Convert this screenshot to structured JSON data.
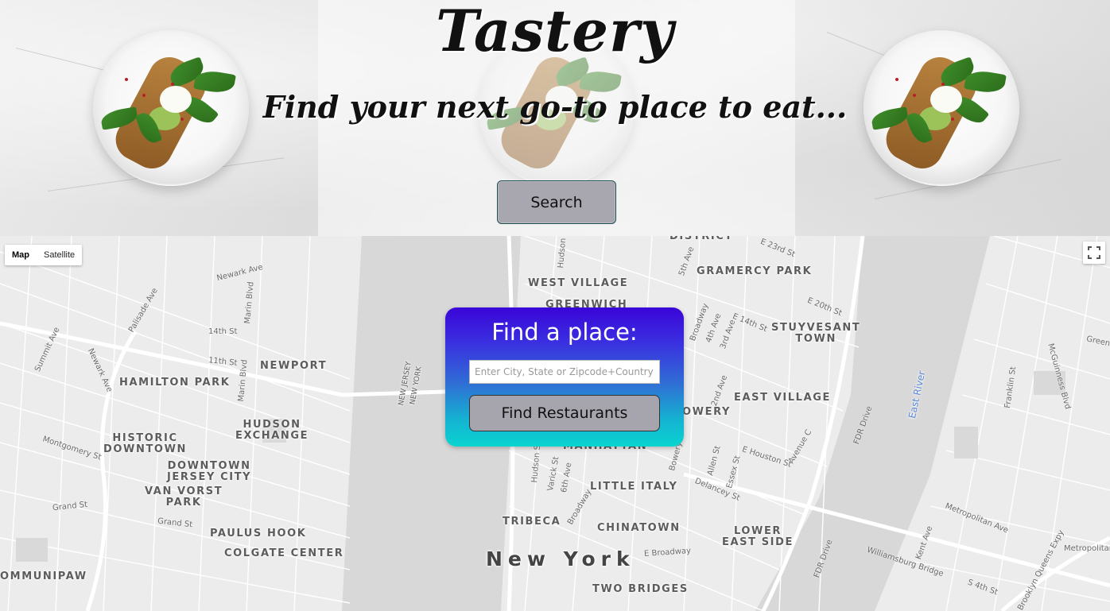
{
  "hero": {
    "title": "Tastery",
    "tagline": "Find your next go-to place to eat...",
    "search_label": "Search"
  },
  "map": {
    "map_type_options": [
      "Map",
      "Satellite"
    ],
    "active_map_type": "Map",
    "fullscreen_icon": "fullscreen-icon",
    "neighborhoods": {
      "district": "DISTRICT",
      "west_village": "WEST VILLAGE",
      "greenwich": "GREENWICH",
      "gramercy_park": "GRAMERCY PARK",
      "stuyvesant_town": "STUYVESANT\nTOWN",
      "newport": "NEWPORT",
      "hamilton_park": "HAMILTON PARK",
      "hudson_exchange": "HUDSON\nEXCHANGE",
      "historic_downtown": "HISTORIC\nDOWNTOWN",
      "downtown_jersey_city": "DOWNTOWN\nJERSEY CITY",
      "van_vorst_park": "VAN VORST\nPARK",
      "paulus_hook": "PAULUS HOOK",
      "colgate_center": "COLGATE CENTER",
      "communipaw": "OMMUNIPAW",
      "east_village": "EAST VILLAGE",
      "bowery": "OWERY",
      "manhattan": "MANHATTAN",
      "little_italy": "LITTLE ITALY",
      "tribeca": "TRIBECA",
      "chinatown": "CHINATOWN",
      "lower_east_side": "LOWER\nEAST SIDE",
      "new_york": "New York",
      "two_bridges": "TWO BRIDGES"
    },
    "streets": {
      "newark_ave": "Newark Ave",
      "marin_blvd": "Marin Blvd",
      "palisade_ave": "Palisade Ave",
      "summit_ave": "Summit Ave",
      "14th_st": "14th St",
      "11th_st": "11th St",
      "newark_ave_2": "Newark Ave",
      "marin_blvd_2": "Marin Blvd",
      "montgomery_st": "Montgomery St",
      "grand_st": "Grand St",
      "grand_st_2": "Grand St",
      "hudson_st": "Hudson St",
      "5th_ave": "5th Ave",
      "e_23rd_st": "E 23rd St",
      "e_20th_st": "E 20th St",
      "broadway": "Broadway",
      "4th_ave": "4th Ave",
      "3rd_ave": "3rd Ave",
      "e_14th_st": "E 14th St",
      "2nd_ave": "2nd Ave",
      "fdr_drive": "FDR Drive",
      "avenue_c": "Avenue C",
      "e_houston_st": "E Houston St",
      "allen_st": "Allen St",
      "essex_st": "Essex St",
      "delancey_st": "Delancey St",
      "bowery_st": "Bowery",
      "hudson_st_2": "Hudson St",
      "varick_st": "Varick St",
      "6th_ave": "6th Ave",
      "broadway_2": "Broadway",
      "e_broadway": "E Broadway",
      "williamsburg_bridge": "Williamsburg Bridge",
      "fdr_drive_2": "FDR Drive",
      "kent_ave": "Kent Ave",
      "metropolitan_ave": "Metropolitan Ave",
      "metropolitan_2": "Metropolitan",
      "brooklyn_queens_expy": "Brooklyn Queens Expy",
      "s_4th_st": "S 4th St",
      "franklin_st": "Franklin St",
      "mcguinness_blvd": "McGuinness Blvd",
      "greenp": "Greenp",
      "nj_ny": "NEW JERSEY\nNEW YORK",
      "east_river": "East River"
    }
  },
  "finder": {
    "title": "Find a place:",
    "placeholder": "Enter City, State or Zipcode+Country",
    "value": "",
    "button_label": "Find Restaurants"
  },
  "colors": {
    "card_top": "#3a05d8",
    "card_bottom": "#08d5d0",
    "button_gray": "#a6a4ad",
    "water": "#d6d6d6",
    "map_land": "#ececec"
  }
}
